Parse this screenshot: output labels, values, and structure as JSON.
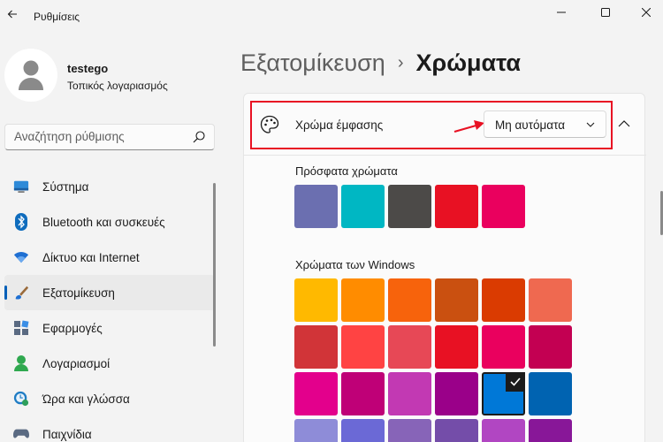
{
  "app": {
    "title": "Ρυθμίσεις"
  },
  "user": {
    "name": "testego",
    "account_type": "Τοπικός λογαριασμός"
  },
  "search": {
    "placeholder": "Αναζήτηση ρύθμισης"
  },
  "nav": {
    "items": [
      {
        "label": "Σύστημα",
        "icon": "system-icon",
        "selected": false
      },
      {
        "label": "Bluetooth και συσκευές",
        "icon": "bluetooth-icon",
        "selected": false
      },
      {
        "label": "Δίκτυο και Internet",
        "icon": "wifi-icon",
        "selected": false
      },
      {
        "label": "Εξατομίκευση",
        "icon": "brush-icon",
        "selected": true
      },
      {
        "label": "Εφαρμογές",
        "icon": "apps-icon",
        "selected": false
      },
      {
        "label": "Λογαριασμοί",
        "icon": "accounts-icon",
        "selected": false
      },
      {
        "label": "Ώρα και γλώσσα",
        "icon": "time-language-icon",
        "selected": false
      },
      {
        "label": "Παιχνίδια",
        "icon": "gaming-icon",
        "selected": false
      }
    ]
  },
  "breadcrumb": {
    "parent": "Εξατομίκευση",
    "separator": "›",
    "current": "Χρώματα"
  },
  "accent": {
    "label": "Χρώμα έμφασης",
    "dropdown_value": "Μη αυτόματα",
    "highlight_color": "#e81123"
  },
  "recent": {
    "label": "Πρόσφατα χρώματα",
    "colors": [
      "#6b6fb0",
      "#00b7c3",
      "#4c4a48",
      "#e81123",
      "#ea005e"
    ]
  },
  "windows_colors": {
    "label": "Χρώματα των Windows",
    "selected_row": 2,
    "selected_col": 4,
    "rows": [
      [
        "#ffb900",
        "#ff8c00",
        "#f7630c",
        "#ca5010",
        "#da3b01",
        "#ef6950"
      ],
      [
        "#d13438",
        "#ff4343",
        "#e74856",
        "#e81123",
        "#ea005e",
        "#c30052"
      ],
      [
        "#e3008c",
        "#bf0077",
        "#c239b3",
        "#9a0089",
        "#0078d7",
        "#0063b1"
      ],
      [
        "#8e8cd8",
        "#6b69d6",
        "#8764b8",
        "#744da9",
        "#b146c2",
        "#881798"
      ]
    ]
  }
}
